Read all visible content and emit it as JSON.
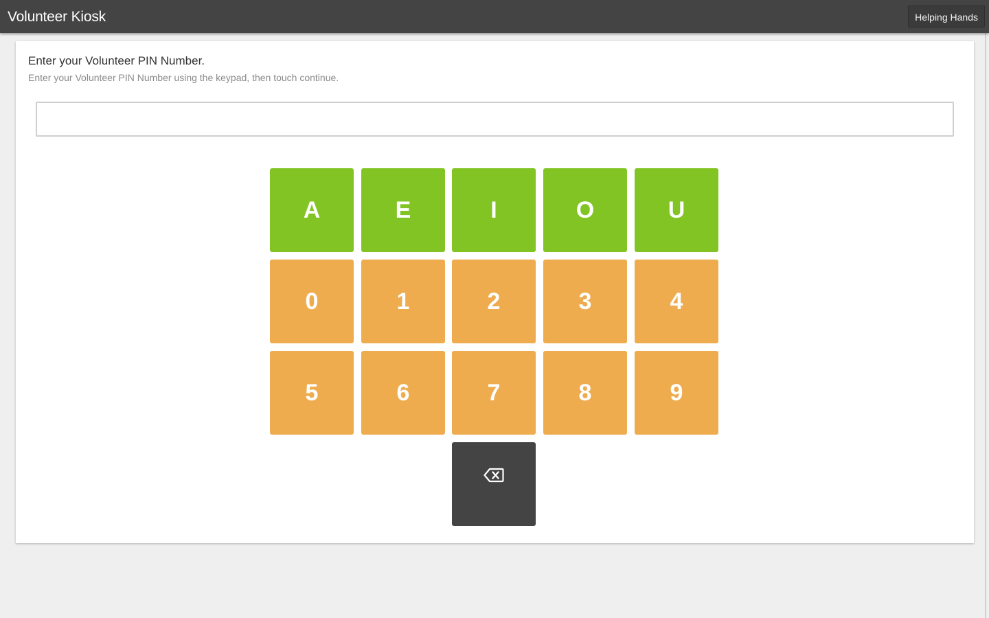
{
  "header": {
    "title": "Volunteer Kiosk",
    "org_button": "Helping Hands"
  },
  "prompt": {
    "title": "Enter your Volunteer PIN Number.",
    "subtitle": "Enter your Volunteer PIN Number using the keypad, then touch continue."
  },
  "pin_input": {
    "value": "",
    "placeholder": ""
  },
  "keypad": {
    "vowels": [
      "A",
      "E",
      "I",
      "O",
      "U"
    ],
    "digits_row1": [
      "0",
      "1",
      "2",
      "3",
      "4"
    ],
    "digits_row2": [
      "5",
      "6",
      "7",
      "8",
      "9"
    ],
    "backspace_icon": "backspace-icon"
  },
  "colors": {
    "header_bg": "#444444",
    "vowel_key": "#82c424",
    "digit_key": "#eeac4f",
    "backspace_key": "#444444",
    "page_bg": "#efefef"
  }
}
